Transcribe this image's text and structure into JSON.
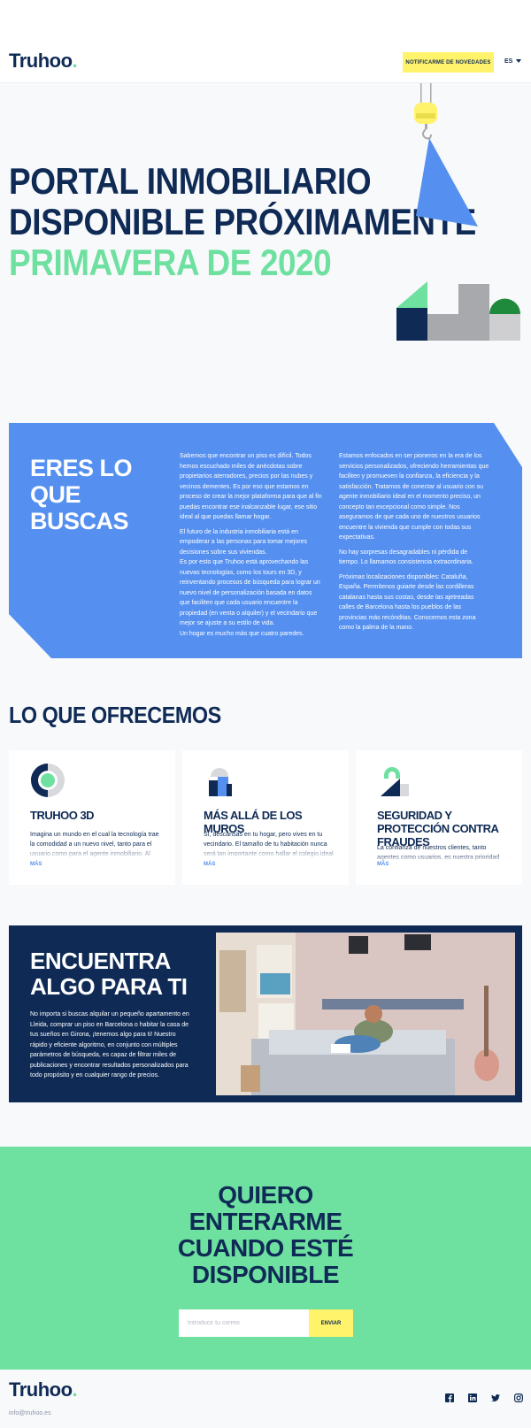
{
  "header": {
    "logo": "Truhoo",
    "logo_dot": ".",
    "notify_button": "NOTIFICARME DE NOVEDADES",
    "language": "ES"
  },
  "hero": {
    "line1": "PORTAL INMOBILIARIO",
    "line2": "DISPONIBLE PRÓXIMAMENTE",
    "subtitle": "PRIMAVERA DE 2020"
  },
  "about": {
    "title": "ERES LO QUE BUSCAS",
    "col1": [
      "Sabemos que encontrar un piso es difícil. Todos hemos escuchado miles de anécdotas sobre propietarios aterradores, precios por las nubes y vecinos dementes. Es por eso que estamos en proceso de crear la mejor plataforma para que al fin puedas encontrar ese inalcanzable lugar, ese sitio ideal al que puedas llamar hogar.",
      "El futuro de la industria inmobiliaria está en empoderar a las personas para tomar mejores decisiones sobre sus viviendas.",
      "Es por esto que Truhoo está aprovechando las nuevas tecnologías, como los tours en 3D, y reinventando procesos de búsqueda para lograr un nuevo nivel de personalización basada en datos que faciliten que cada usuario encuentre la propiedad (en venta o alquiler) y el vecindario que mejor se ajuste a su estilo de vida.",
      "Un hogar es mucho más que cuatro paredes."
    ],
    "col2": [
      "Estamos enfocados en ser pioneros en la era de los servicios personalizados, ofreciendo herramientas que faciliten y promueven la confianza, la eficiencia y la satisfacción. Tratamos de conectar al usuario con su agente inmobiliario ideal en el momento preciso, un concepto tan excepcional como simple. Nos aseguramos de que cada uno de nuestros usuarios encuentre la vivienda que cumple con todas sus expectativas.",
      "No hay sorpresas desagradables ni pérdida de tiempo. Lo llamamos consistencia extraordinaria.",
      "Próximas localizaciones disponibles: Cataluña, España. Permítenos guiarte desde las cordilleras catalanas hasta sus costas, desde las ajetreadas calles de Barcelona hasta los pueblos de las provincias más recónditas. Conocemos esta zona como la palma de la mano."
    ]
  },
  "offer": {
    "title": "LO QUE OFRECEMOS",
    "cards": [
      {
        "title": "TRUHOO 3D",
        "desc": "Imagina un mundo en el cual la tecnología trae la comodidad a un nuevo nivel, tanto para el usuario como para el agente inmobiliario. Al proporcionar",
        "more": "MÁS"
      },
      {
        "title": "MÁS ALLÁ DE LOS MUROS",
        "desc": "Sí, descansas en tu hogar, pero vives en tu vecindario. El tamaño de tu habitación nunca será tan importante como hallar el colegio ideal para",
        "more": "MÁS"
      },
      {
        "title": "SEGURIDAD Y PROTECCIÓN CONTRA FRAUDES",
        "desc": "La confianza de nuestros clientes, tanto agentes como usuarios, es nuestra prioridad número uno.",
        "more": "MÁS"
      }
    ]
  },
  "find": {
    "title": "ENCUENTRA ALGO PARA TI",
    "text": "No importa si buscas alquilar un pequeño apartamento en Lleida, comprar un piso en Barcelona o habitar la casa de tus sueños en Girona, ¡tenemos algo para ti! Nuestro rápido y eficiente algoritmo, en conjunto con múltiples parámetros de búsqueda, es capaz de filtrar miles de publicaciones y encontrar resultados personalizados para todo propósito y en cualquier rango de precios."
  },
  "signup": {
    "title_lines": [
      "QUIERO",
      "ENTERARME",
      "CUANDO ESTÉ",
      "DISPONIBLE"
    ],
    "email_placeholder": "Introducir tu correo",
    "send_button": "ENVIAR"
  },
  "footer": {
    "logo": "Truhoo",
    "logo_dot": ".",
    "email": "info@truhoo.es",
    "social": [
      "facebook-icon",
      "linkedin-icon",
      "twitter-icon",
      "instagram-icon"
    ]
  },
  "colors": {
    "navy": "#0f2b55",
    "blue": "#5590f0",
    "green": "#6ee0a0",
    "yellow": "#fff36b"
  }
}
